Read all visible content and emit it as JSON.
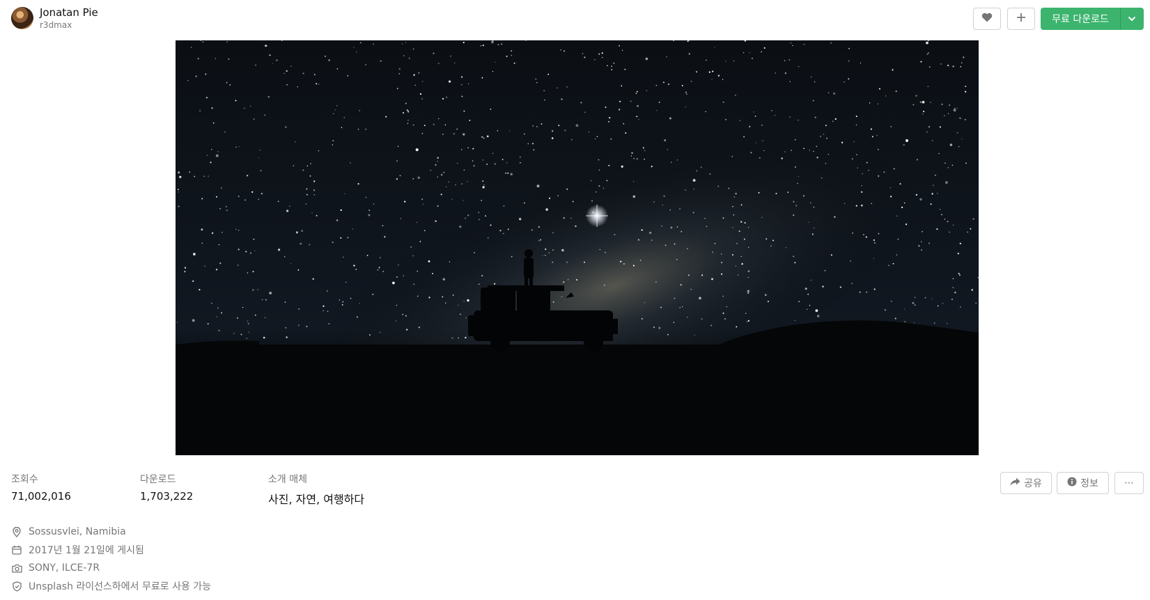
{
  "author": {
    "name": "Jonatan Pie",
    "handle": "r3dmax"
  },
  "toolbar": {
    "like_icon": "heart-icon",
    "add_icon": "plus-icon",
    "download_label": "무료 다운로드",
    "download_dropdown_icon": "chevron-down-icon",
    "accent_color": "#3cb46e"
  },
  "photo": {
    "description_icon": "photo"
  },
  "stats": {
    "views_label": "조회수",
    "views_value": "71,002,016",
    "downloads_label": "다운로드",
    "downloads_value": "1,703,222",
    "media_label": "소개 매체",
    "media_value": "사진, 자연, 여행하다"
  },
  "actions": {
    "share_label": "공유",
    "info_label": "정보",
    "more_label": "⋯"
  },
  "meta": {
    "location": "Sossusvlei, Namibia",
    "published": "2017년 1월 21일에 게시됨",
    "camera": "SONY, ILCE-7R",
    "license": "Unsplash 라이선스하에서 무료로 사용 가능"
  }
}
